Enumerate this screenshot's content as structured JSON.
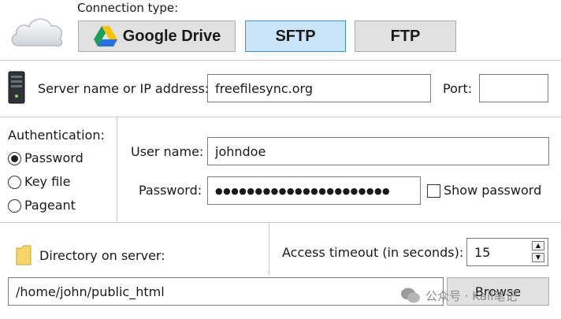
{
  "connection": {
    "label": "Connection type:",
    "options": [
      "Google Drive",
      "SFTP",
      "FTP"
    ],
    "selected": "SFTP"
  },
  "server": {
    "label": "Server name or IP address:",
    "value": "freefilesync.org",
    "port_label": "Port:",
    "port_value": ""
  },
  "auth": {
    "label": "Authentication:",
    "options": [
      "Password",
      "Key file",
      "Pageant"
    ],
    "selected": "Password",
    "username_label": "User name:",
    "username_value": "johndoe",
    "password_label": "Password:",
    "password_value": "●●●●●●●●●●●●●●●●●●●●●●",
    "show_password_label": "Show password"
  },
  "directory": {
    "label": "Directory on server:",
    "value": "/home/john/public_html",
    "browse_label": "Browse"
  },
  "timeout": {
    "label": "Access timeout (in seconds):",
    "value": "15"
  },
  "watermark": {
    "text": "公众号 · Kali笔记"
  },
  "colors": {
    "selected_bg": "#cce4f7",
    "selected_border": "#3c8ed8",
    "button_bg": "#e1e1e1"
  }
}
